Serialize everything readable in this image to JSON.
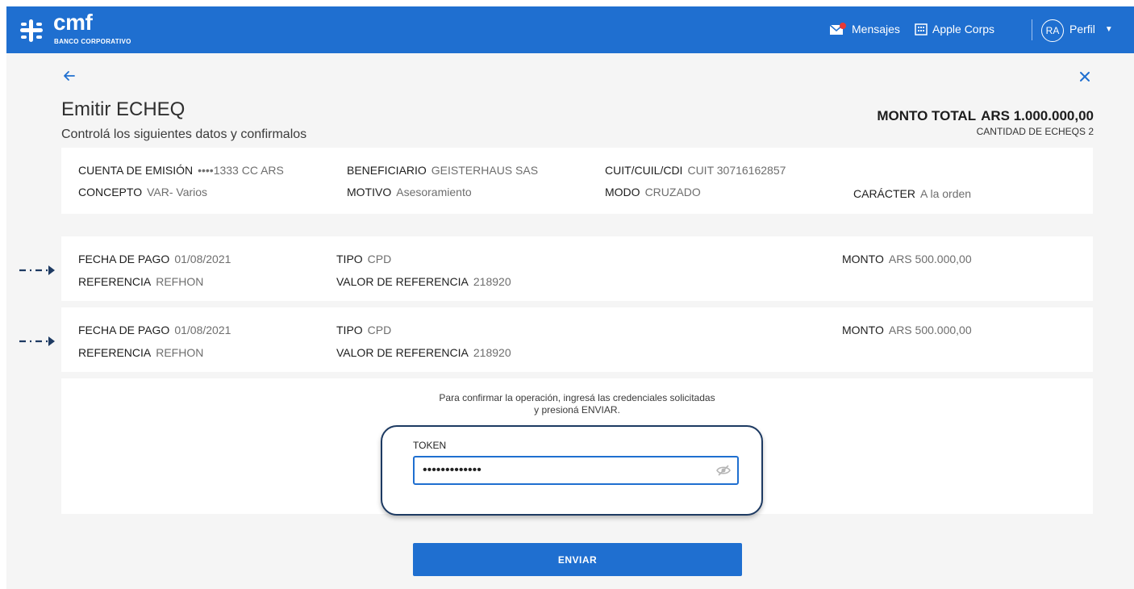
{
  "header": {
    "brand": "cmf",
    "brand_sub": "BANCO CORPORATIVO",
    "messages_label": "Mensajes",
    "company_label": "Apple Corps",
    "avatar_initials": "RA",
    "profile_label": "Perfil"
  },
  "page": {
    "title": "Emitir ECHEQ",
    "subtitle": "Controlá los siguientes datos y confirmalos",
    "total_label": "MONTO TOTAL",
    "total_value": "ARS 1.000.000,00",
    "qty_label": "CANTIDAD DE ECHEQS 2"
  },
  "summary": {
    "cuenta_label": "CUENTA DE EMISIÓN",
    "cuenta_value": "••••1333  CC ARS",
    "beneficiario_label": "BENEFICIARIO",
    "beneficiario_value": "GEISTERHAUS SAS",
    "cuit_label": "CUIT/CUIL/CDI",
    "cuit_value": "CUIT 30716162857",
    "concepto_label": "CONCEPTO",
    "concepto_value": "VAR- Varios",
    "motivo_label": "MOTIVO",
    "motivo_value": "Asesoramiento",
    "modo_label": "MODO",
    "modo_value": "CRUZADO",
    "caracter_label": "CARÁCTER",
    "caracter_value": "A la orden"
  },
  "echeqs": [
    {
      "fecha_label": "FECHA DE PAGO",
      "fecha_value": "01/08/2021",
      "tipo_label": "TIPO",
      "tipo_value": "CPD",
      "monto_label": "MONTO",
      "monto_value": "ARS 500.000,00",
      "ref_label": "REFERENCIA",
      "ref_value": "REFHON",
      "valor_label": "VALOR DE REFERENCIA",
      "valor_value": "218920"
    },
    {
      "fecha_label": "FECHA DE PAGO",
      "fecha_value": "01/08/2021",
      "tipo_label": "TIPO",
      "tipo_value": "CPD",
      "monto_label": "MONTO",
      "monto_value": "ARS 500.000,00",
      "ref_label": "REFERENCIA",
      "ref_value": "REFHON",
      "valor_label": "VALOR DE REFERENCIA",
      "valor_value": "218920"
    }
  ],
  "confirm": {
    "line1": "Para confirmar la operación, ingresá las credenciales solicitadas",
    "line2": "y presioná ENVIAR.",
    "token_label": "TOKEN",
    "token_value": "•••••••••••••",
    "submit_label": "ENVIAR"
  },
  "colors": {
    "primary": "#1f6fd0",
    "annotation": "#1d3a62"
  }
}
